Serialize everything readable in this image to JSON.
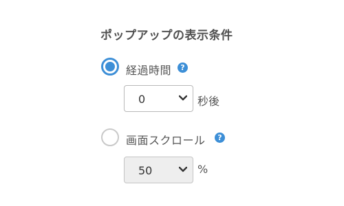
{
  "section": {
    "title": "ポップアップの表示条件"
  },
  "options": {
    "elapsed_time": {
      "label": "経過時間",
      "selected": true,
      "select_value": "0",
      "suffix": "秒後"
    },
    "scroll": {
      "label": "画面スクロール",
      "selected": false,
      "select_value": "50",
      "suffix": "%"
    }
  },
  "icons": {
    "help": "?"
  },
  "colors": {
    "accent": "#3d8fd7",
    "disabled_bg": "#eeeeee"
  }
}
